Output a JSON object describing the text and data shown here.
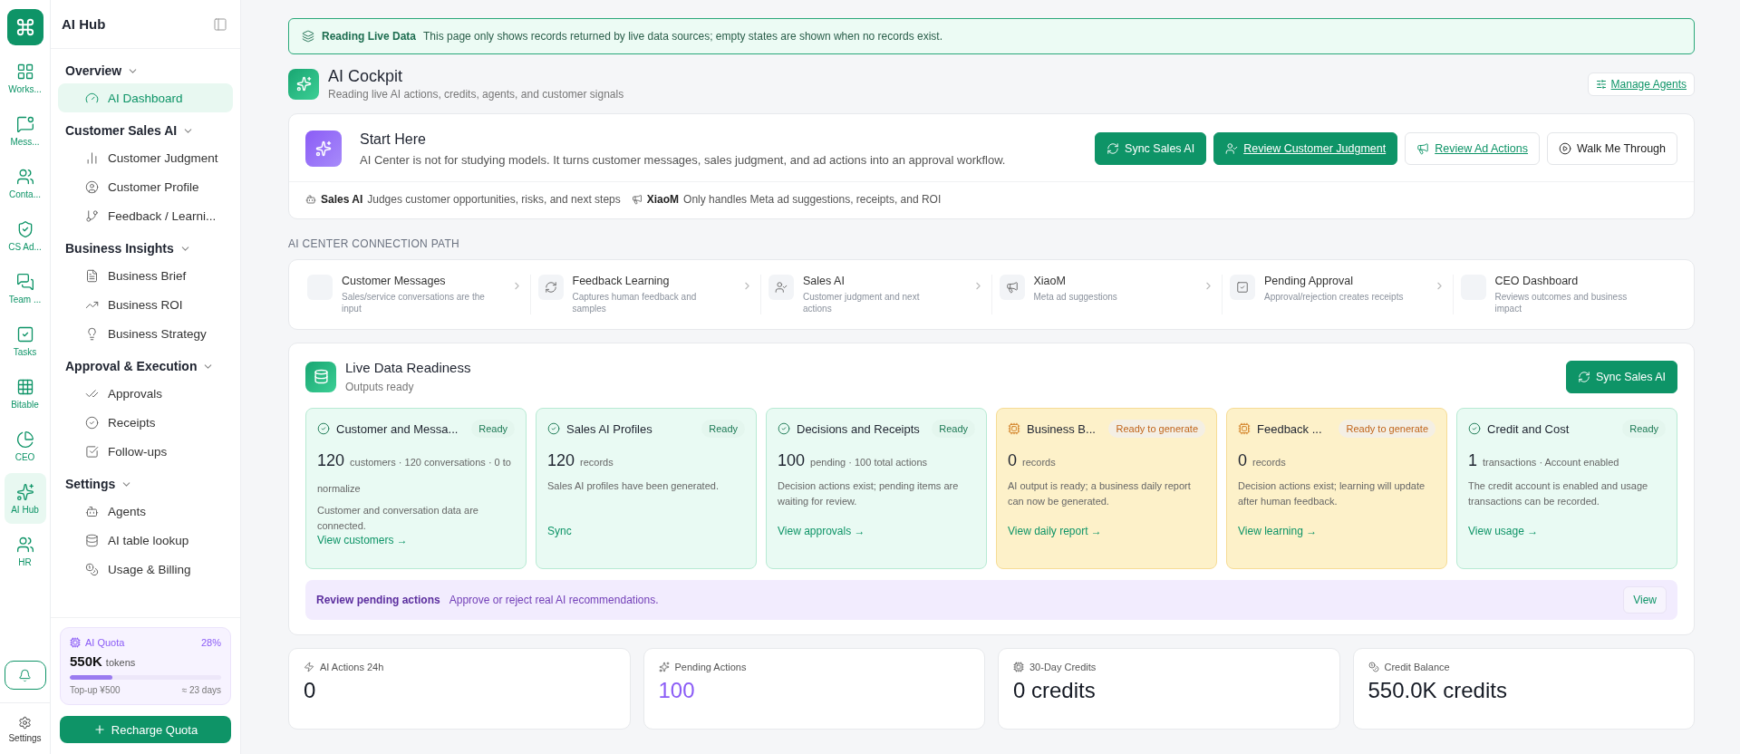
{
  "rail": {
    "items": [
      {
        "label": "Works...",
        "selected": false
      },
      {
        "label": "Mess...",
        "selected": false
      },
      {
        "label": "Conta...",
        "selected": false
      },
      {
        "label": "CS Ad...",
        "selected": false
      },
      {
        "label": "Team ...",
        "selected": false
      },
      {
        "label": "Tasks",
        "selected": false
      },
      {
        "label": "Bitable",
        "selected": false
      },
      {
        "label": "CEO",
        "selected": false
      },
      {
        "label": "AI Hub",
        "selected": true
      },
      {
        "label": "HR",
        "selected": false
      }
    ],
    "settings": "Settings"
  },
  "sidebar": {
    "title": "AI Hub",
    "groups": [
      {
        "label": "Overview",
        "expanded": true,
        "items": [
          {
            "label": "AI Dashboard",
            "selected": true
          }
        ]
      },
      {
        "label": "Customer Sales AI",
        "expanded": true,
        "items": [
          {
            "label": "Customer Judgment",
            "selected": false
          },
          {
            "label": "Customer Profile",
            "selected": false
          },
          {
            "label": "Feedback / Learni...",
            "selected": false
          }
        ]
      },
      {
        "label": "Business Insights",
        "expanded": true,
        "items": [
          {
            "label": "Business Brief",
            "selected": false
          },
          {
            "label": "Business ROI",
            "selected": false
          },
          {
            "label": "Business Strategy",
            "selected": false
          }
        ]
      },
      {
        "label": "Approval & Execution",
        "expanded": true,
        "items": [
          {
            "label": "Approvals",
            "selected": false
          },
          {
            "label": "Receipts",
            "selected": false
          },
          {
            "label": "Follow-ups",
            "selected": false
          }
        ]
      },
      {
        "label": "Settings",
        "expanded": true,
        "items": [
          {
            "label": "Agents",
            "selected": false
          },
          {
            "label": "AI table lookup",
            "selected": false
          },
          {
            "label": "Usage & Billing",
            "selected": false
          }
        ]
      }
    ],
    "quota": {
      "label": "AI Quota",
      "percent": "28%",
      "level": 0.28,
      "amount": "550K",
      "unit": "tokens",
      "topup": "Top-up ¥500",
      "days": "≈ 23 days"
    },
    "recharge": "Recharge Quota"
  },
  "banner": {
    "title": "Reading Live Data",
    "text": "This page only shows records returned by live data sources; empty states are shown when no records exist."
  },
  "header": {
    "title": "AI Cockpit",
    "subtitle": "Reading live AI actions, credits, agents, and customer signals",
    "action": "Manage Agents"
  },
  "start": {
    "title": "Start Here",
    "text": "AI Center is not for studying models. It turns customer messages, sales judgment, and ad actions into an approval workflow.",
    "buttons": [
      {
        "label": "Sync Sales AI",
        "kind": "primary",
        "underline": false
      },
      {
        "label": "Review Customer Judgment",
        "kind": "primary",
        "underline": true
      },
      {
        "label": "Review Ad Actions",
        "kind": "outline",
        "underline": true
      },
      {
        "label": "Walk Me Through",
        "kind": "plain",
        "underline": false
      }
    ],
    "agents": [
      {
        "name": "Sales AI",
        "text": "Judges customer opportunities, risks, and next steps"
      },
      {
        "name": "XiaoM",
        "text": "Only handles Meta ad suggestions, receipts, and ROI"
      }
    ]
  },
  "path": {
    "label": "AI CENTER CONNECTION PATH",
    "steps": [
      {
        "title": "Customer Messages",
        "text": "Sales/service conversations are the input"
      },
      {
        "title": "Feedback Learning",
        "text": "Captures human feedback and samples"
      },
      {
        "title": "Sales AI",
        "text": "Customer judgment and next actions"
      },
      {
        "title": "XiaoM",
        "text": "Meta ad suggestions"
      },
      {
        "title": "Pending Approval",
        "text": "Approval/rejection creates receipts"
      },
      {
        "title": "CEO Dashboard",
        "text": "Reviews outcomes and business impact"
      }
    ]
  },
  "readiness": {
    "title": "Live Data Readiness",
    "subtitle": "Outputs ready",
    "action": "Sync Sales AI",
    "cards": [
      {
        "kind": "ready",
        "title": "Customer and Messa...",
        "status": "Ready",
        "value": "120",
        "detail": "customers · 120 conversations · 0 to normalize",
        "text": "Customer and conversation data are connected.",
        "link": "View customers →"
      },
      {
        "kind": "ready",
        "title": "Sales AI Profiles",
        "status": "Ready",
        "value": "120",
        "detail": "records",
        "text": "Sales AI profiles have been generated.",
        "link": "Sync"
      },
      {
        "kind": "ready",
        "title": "Decisions and Receipts",
        "status": "Ready",
        "value": "100",
        "detail": "pending · 100 total actions",
        "text": "Decision actions exist; pending items are waiting for review.",
        "link": "View approvals →"
      },
      {
        "kind": "pending",
        "title": "Business B...",
        "status": "Ready to generate",
        "value": "0",
        "detail": "records",
        "text": "AI output is ready; a business daily report can now be generated.",
        "link": "View daily report →"
      },
      {
        "kind": "pending",
        "title": "Feedback ...",
        "status": "Ready to generate",
        "value": "0",
        "detail": "records",
        "text": "Decision actions exist; learning will update after human feedback.",
        "link": "View learning →"
      },
      {
        "kind": "ready",
        "title": "Credit and Cost",
        "status": "Ready",
        "value": "1",
        "detail": "transactions · Account enabled",
        "text": "The credit account is enabled and usage transactions can be recorded.",
        "link": "View usage →"
      }
    ],
    "review": {
      "title": "Review pending actions",
      "text": "Approve or reject real AI recommendations.",
      "action": "View"
    }
  },
  "stats": [
    {
      "label": "AI Actions 24h",
      "value": "0",
      "accent": false
    },
    {
      "label": "Pending Actions",
      "value": "100",
      "accent": true
    },
    {
      "label": "30-Day Credits",
      "value": "0 credits",
      "accent": false
    },
    {
      "label": "Credit Balance",
      "value": "550.0K credits",
      "accent": false
    }
  ]
}
